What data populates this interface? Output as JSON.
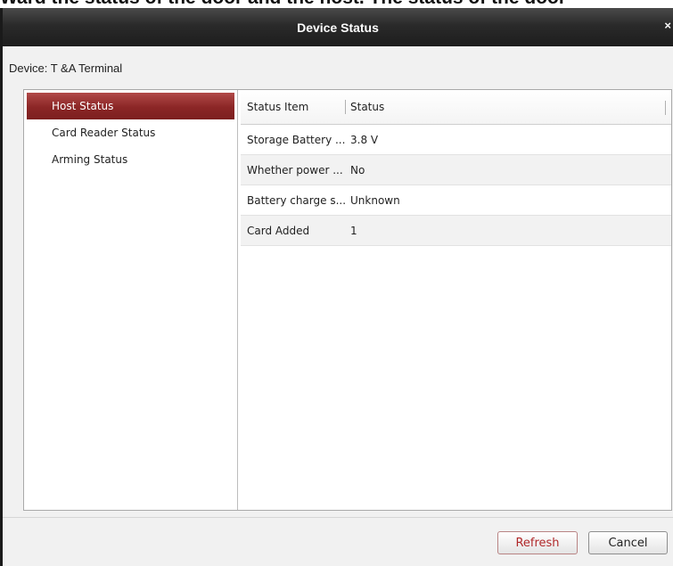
{
  "page_top_text": "Ward the status of the door and the host. The status of the door",
  "dialog": {
    "title": "Device Status",
    "close_glyph": "×",
    "device_label": "Device: T &A Terminal"
  },
  "sidebar": {
    "items": [
      {
        "label": "Host Status",
        "active": true
      },
      {
        "label": "Card Reader Status",
        "active": false
      },
      {
        "label": "Arming Status",
        "active": false
      }
    ]
  },
  "table": {
    "headers": {
      "item": "Status Item",
      "status": "Status"
    },
    "rows": [
      {
        "item": "Storage Battery ...",
        "status": "3.8 V"
      },
      {
        "item": "Whether power ...",
        "status": "No"
      },
      {
        "item": "Battery charge s...",
        "status": "Unknown"
      },
      {
        "item": "Card Added",
        "status": "1"
      }
    ]
  },
  "buttons": {
    "refresh": "Refresh",
    "cancel": "Cancel"
  },
  "colors": {
    "titlebar": "#2a2a2a",
    "active_item": "#8b2626",
    "refresh_text": "#b0282a"
  },
  "icons": {
    "close": "close-icon"
  }
}
